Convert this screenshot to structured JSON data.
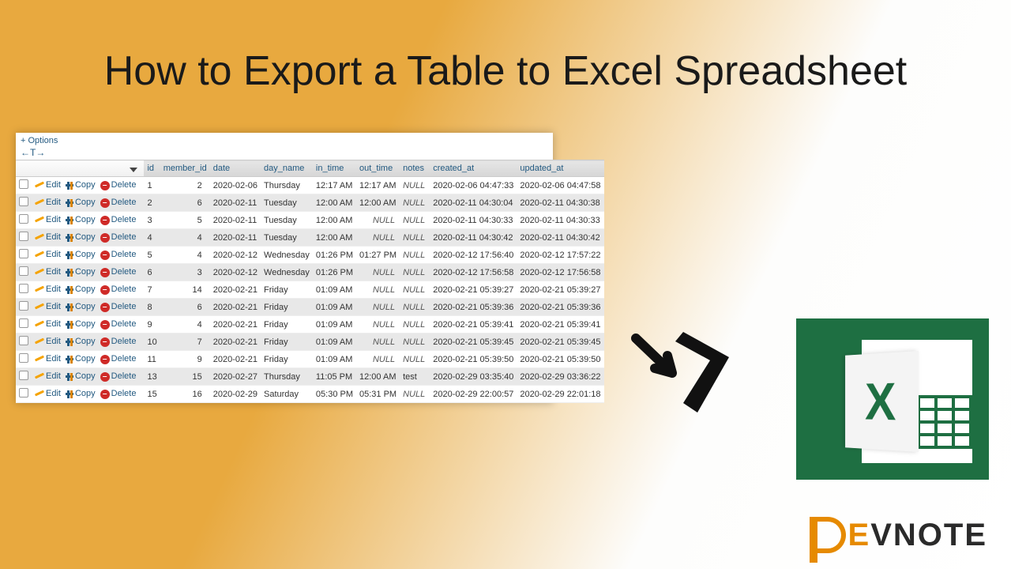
{
  "title": "How to Export a Table to Excel Spreadsheet",
  "table": {
    "options_label": "+ Options",
    "arrows": "←T→",
    "action_labels": {
      "edit": "Edit",
      "copy": "Copy",
      "delete": "Delete"
    },
    "columns": [
      "id",
      "member_id",
      "date",
      "day_name",
      "in_time",
      "out_time",
      "notes",
      "created_at",
      "updated_at"
    ],
    "rows": [
      {
        "id": "1",
        "member_id": "2",
        "date": "2020-02-06",
        "day_name": "Thursday",
        "in_time": "12:17 AM",
        "out_time": "12:17 AM",
        "notes": "NULL",
        "created_at": "2020-02-06 04:47:33",
        "updated_at": "2020-02-06 04:47:58"
      },
      {
        "id": "2",
        "member_id": "6",
        "date": "2020-02-11",
        "day_name": "Tuesday",
        "in_time": "12:00 AM",
        "out_time": "12:00 AM",
        "notes": "NULL",
        "created_at": "2020-02-11 04:30:04",
        "updated_at": "2020-02-11 04:30:38"
      },
      {
        "id": "3",
        "member_id": "5",
        "date": "2020-02-11",
        "day_name": "Tuesday",
        "in_time": "12:00 AM",
        "out_time": "NULL",
        "notes": "NULL",
        "created_at": "2020-02-11 04:30:33",
        "updated_at": "2020-02-11 04:30:33"
      },
      {
        "id": "4",
        "member_id": "4",
        "date": "2020-02-11",
        "day_name": "Tuesday",
        "in_time": "12:00 AM",
        "out_time": "NULL",
        "notes": "NULL",
        "created_at": "2020-02-11 04:30:42",
        "updated_at": "2020-02-11 04:30:42"
      },
      {
        "id": "5",
        "member_id": "4",
        "date": "2020-02-12",
        "day_name": "Wednesday",
        "in_time": "01:26 PM",
        "out_time": "01:27 PM",
        "notes": "NULL",
        "created_at": "2020-02-12 17:56:40",
        "updated_at": "2020-02-12 17:57:22"
      },
      {
        "id": "6",
        "member_id": "3",
        "date": "2020-02-12",
        "day_name": "Wednesday",
        "in_time": "01:26 PM",
        "out_time": "NULL",
        "notes": "NULL",
        "created_at": "2020-02-12 17:56:58",
        "updated_at": "2020-02-12 17:56:58"
      },
      {
        "id": "7",
        "member_id": "14",
        "date": "2020-02-21",
        "day_name": "Friday",
        "in_time": "01:09 AM",
        "out_time": "NULL",
        "notes": "NULL",
        "created_at": "2020-02-21 05:39:27",
        "updated_at": "2020-02-21 05:39:27"
      },
      {
        "id": "8",
        "member_id": "6",
        "date": "2020-02-21",
        "day_name": "Friday",
        "in_time": "01:09 AM",
        "out_time": "NULL",
        "notes": "NULL",
        "created_at": "2020-02-21 05:39:36",
        "updated_at": "2020-02-21 05:39:36"
      },
      {
        "id": "9",
        "member_id": "4",
        "date": "2020-02-21",
        "day_name": "Friday",
        "in_time": "01:09 AM",
        "out_time": "NULL",
        "notes": "NULL",
        "created_at": "2020-02-21 05:39:41",
        "updated_at": "2020-02-21 05:39:41"
      },
      {
        "id": "10",
        "member_id": "7",
        "date": "2020-02-21",
        "day_name": "Friday",
        "in_time": "01:09 AM",
        "out_time": "NULL",
        "notes": "NULL",
        "created_at": "2020-02-21 05:39:45",
        "updated_at": "2020-02-21 05:39:45"
      },
      {
        "id": "11",
        "member_id": "9",
        "date": "2020-02-21",
        "day_name": "Friday",
        "in_time": "01:09 AM",
        "out_time": "NULL",
        "notes": "NULL",
        "created_at": "2020-02-21 05:39:50",
        "updated_at": "2020-02-21 05:39:50"
      },
      {
        "id": "13",
        "member_id": "15",
        "date": "2020-02-27",
        "day_name": "Thursday",
        "in_time": "11:05 PM",
        "out_time": "12:00 AM",
        "notes": "test",
        "created_at": "2020-02-29 03:35:40",
        "updated_at": "2020-02-29 03:36:22"
      },
      {
        "id": "15",
        "member_id": "16",
        "date": "2020-02-29",
        "day_name": "Saturday",
        "in_time": "05:30 PM",
        "out_time": "05:31 PM",
        "notes": "NULL",
        "created_at": "2020-02-29 22:00:57",
        "updated_at": "2020-02-29 22:01:18"
      }
    ]
  },
  "excel": {
    "letter": "X"
  },
  "logo": {
    "d": "D",
    "rest": "EVNOTE",
    "accent_first": "E"
  }
}
